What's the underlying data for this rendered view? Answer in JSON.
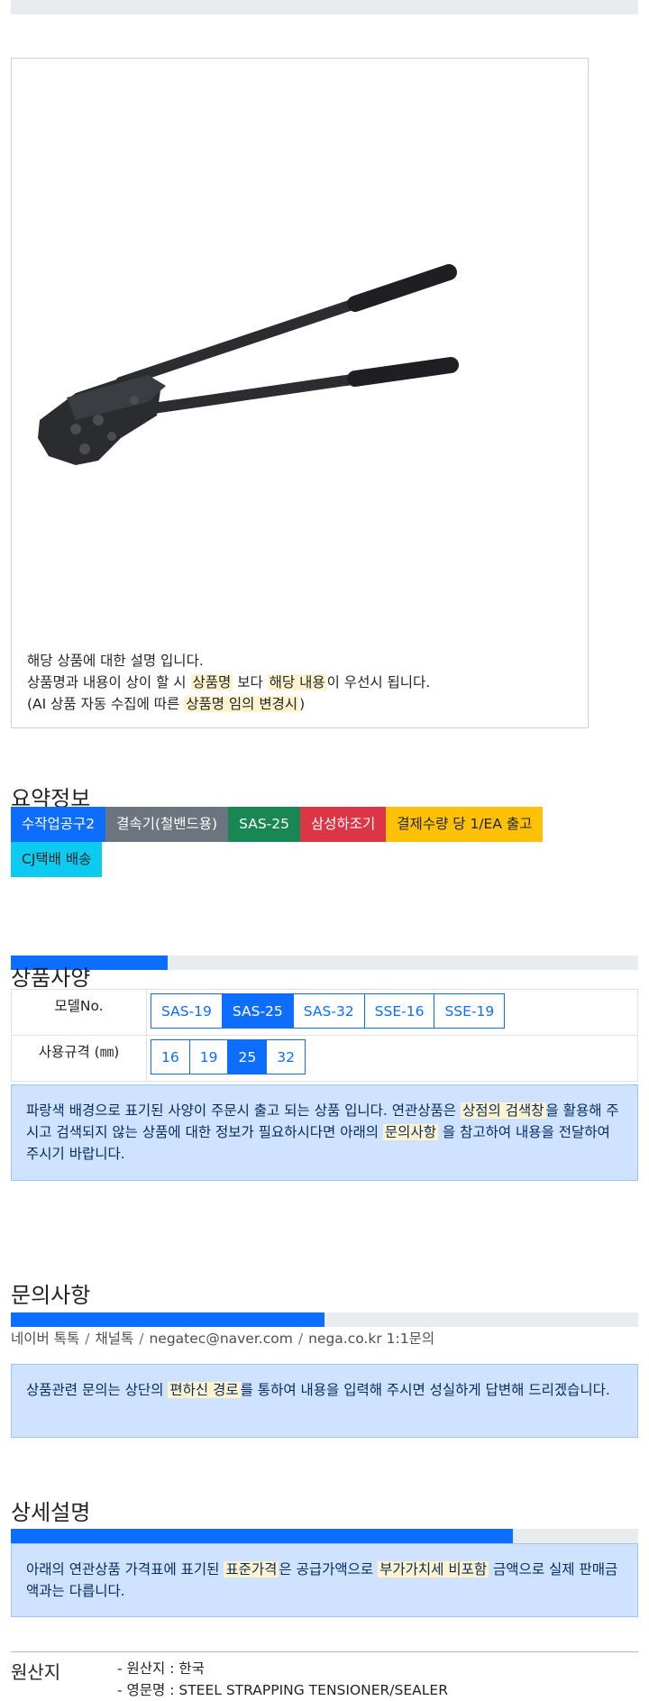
{
  "product": {
    "image_alt": "steel strapping sealer",
    "desc_line1": "해당 상품에 대한 설명 입니다.",
    "desc_line2_a": "상품명과 내용이 상이 할 시 ",
    "desc_line2_hl1": "상품명",
    "desc_line2_b": " 보다 ",
    "desc_line2_hl2": "해당 내용",
    "desc_line2_c": "이 우선시 됩니다.",
    "desc_line3_a": "(AI 상품 자동 수집에 따른 ",
    "desc_line3_hl": "상품명 임의 변경시",
    "desc_line3_b": ")"
  },
  "summary": {
    "title": "요약정보",
    "badges": [
      {
        "label": "수작업공구2",
        "color": "#0d6efd"
      },
      {
        "label": "결속기(철밴드용)",
        "color": "#6c757d"
      },
      {
        "label": "SAS-25",
        "color": "#198754"
      },
      {
        "label": "삼성하조기",
        "color": "#dc3545"
      },
      {
        "label": "결제수량 당 1/EA 출고",
        "color": "#ffc107"
      },
      {
        "label": "CJ택배 배송",
        "color": "#0dcaf0"
      }
    ],
    "progress": 0.25
  },
  "spec": {
    "title": "상품사양",
    "model_label": "모델No.",
    "models": [
      "SAS-19",
      "SAS-25",
      "SAS-32",
      "SSE-16",
      "SSE-19"
    ],
    "model_selected": "SAS-25",
    "size_label": "사용규격 (㎜)",
    "sizes": [
      "16",
      "19",
      "25",
      "32"
    ],
    "size_selected": "25",
    "notice_a": "파랑색 배경으로 표기된 사양이 주문시 출고 되는 상품 입니다. 연관상품은 ",
    "notice_hl1": "상점의 검색창",
    "notice_b": "을 활용해 주시고 검색되지 않는 상품에 대한 정보가 필요하시다면 아래의 ",
    "notice_hl2": "문의사항",
    "notice_c": " 을 참고하여 내용을 전달하여 주시기 바랍니다."
  },
  "inquiry": {
    "title": "문의사항",
    "progress": 0.5,
    "channels": [
      "네이버 톡톡",
      "채널톡",
      "negatec@naver.com",
      "nega.co.kr 1:1문의"
    ],
    "separator": "/",
    "notice_a": "상품관련 문의는 상단의 ",
    "notice_hl": "편하신 경로",
    "notice_b": "를 통하여 내용을 입력해 주시면 성실하게 답변해 드리겠습니다."
  },
  "detail": {
    "title": "상세설명",
    "progress": 0.8,
    "notice_a": "아래의 연관상품 가격표에 표기된 ",
    "notice_hl1": "표준가격",
    "notice_b": "은 공급가액으로 ",
    "notice_hl2": "부가가치세 비포함",
    "notice_c": " 금액으로 실제 판매금액과는 다릅니다."
  },
  "origin": {
    "title": "원산지",
    "line1": "- 원산지 : 한국",
    "line2": "- 영문명 : STEEL STRAPPING TENSIONER/SEALER"
  }
}
